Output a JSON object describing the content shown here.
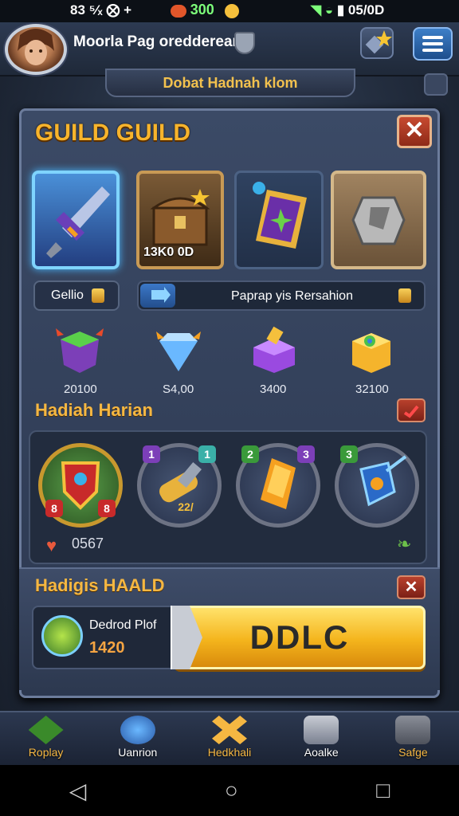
{
  "status_bar": {
    "left_text": "83 ⁵⁄ₓ ⨂ +",
    "coin_value": "300",
    "right_text": "05/0D"
  },
  "header": {
    "player_name": "Moorla Pag oreddeream",
    "banner_text": "Dobat Hadnah klom"
  },
  "panel": {
    "title": "GUILD GUILD",
    "close_label": "✕",
    "items": [
      {
        "name": "crystal-sword",
        "value": ""
      },
      {
        "name": "treasure-chest",
        "value": "13K0 0D"
      },
      {
        "name": "purple-shield",
        "value": ""
      },
      {
        "name": "stone-rune",
        "value": ""
      }
    ],
    "tab_left": "Gellio",
    "tab_right": "Paprap yis Rersahion",
    "gems": [
      {
        "name": "green-gem-box",
        "value": "20100"
      },
      {
        "name": "blue-gem",
        "value": "S4,00"
      },
      {
        "name": "purple-gem-cube",
        "value": "3400"
      },
      {
        "name": "gold-gem-cube",
        "value": "32100"
      }
    ],
    "daily_title": "Hadiah Harian",
    "rewards": [
      {
        "name": "green-shield-reward",
        "badge_left": "8",
        "badge_right": "8"
      },
      {
        "name": "scroll-reward",
        "badge_top_left": "1",
        "badge_top_right": "1",
        "badge_bottom": "22/"
      },
      {
        "name": "crystal-reward",
        "badge_top_left": "2",
        "badge_top_right": "3"
      },
      {
        "name": "blue-shield-reward",
        "badge_top_left": "3"
      }
    ],
    "reward_count": "0567",
    "offer_title": "Hadigis HAALD",
    "offer_name": "Dedrod Plof",
    "offer_price": "1420",
    "buy_label": "DDLC"
  },
  "bottom_nav": [
    {
      "label": "Roplay",
      "color": "#6cc04a"
    },
    {
      "label": "Uanrion",
      "color": "#4a9ae8"
    },
    {
      "label": "Hedkhali",
      "color": "#f5b742"
    },
    {
      "label": "Aoalke",
      "color": "#c8ccd4"
    },
    {
      "label": "Safge",
      "color": "#9a9aa4"
    }
  ]
}
